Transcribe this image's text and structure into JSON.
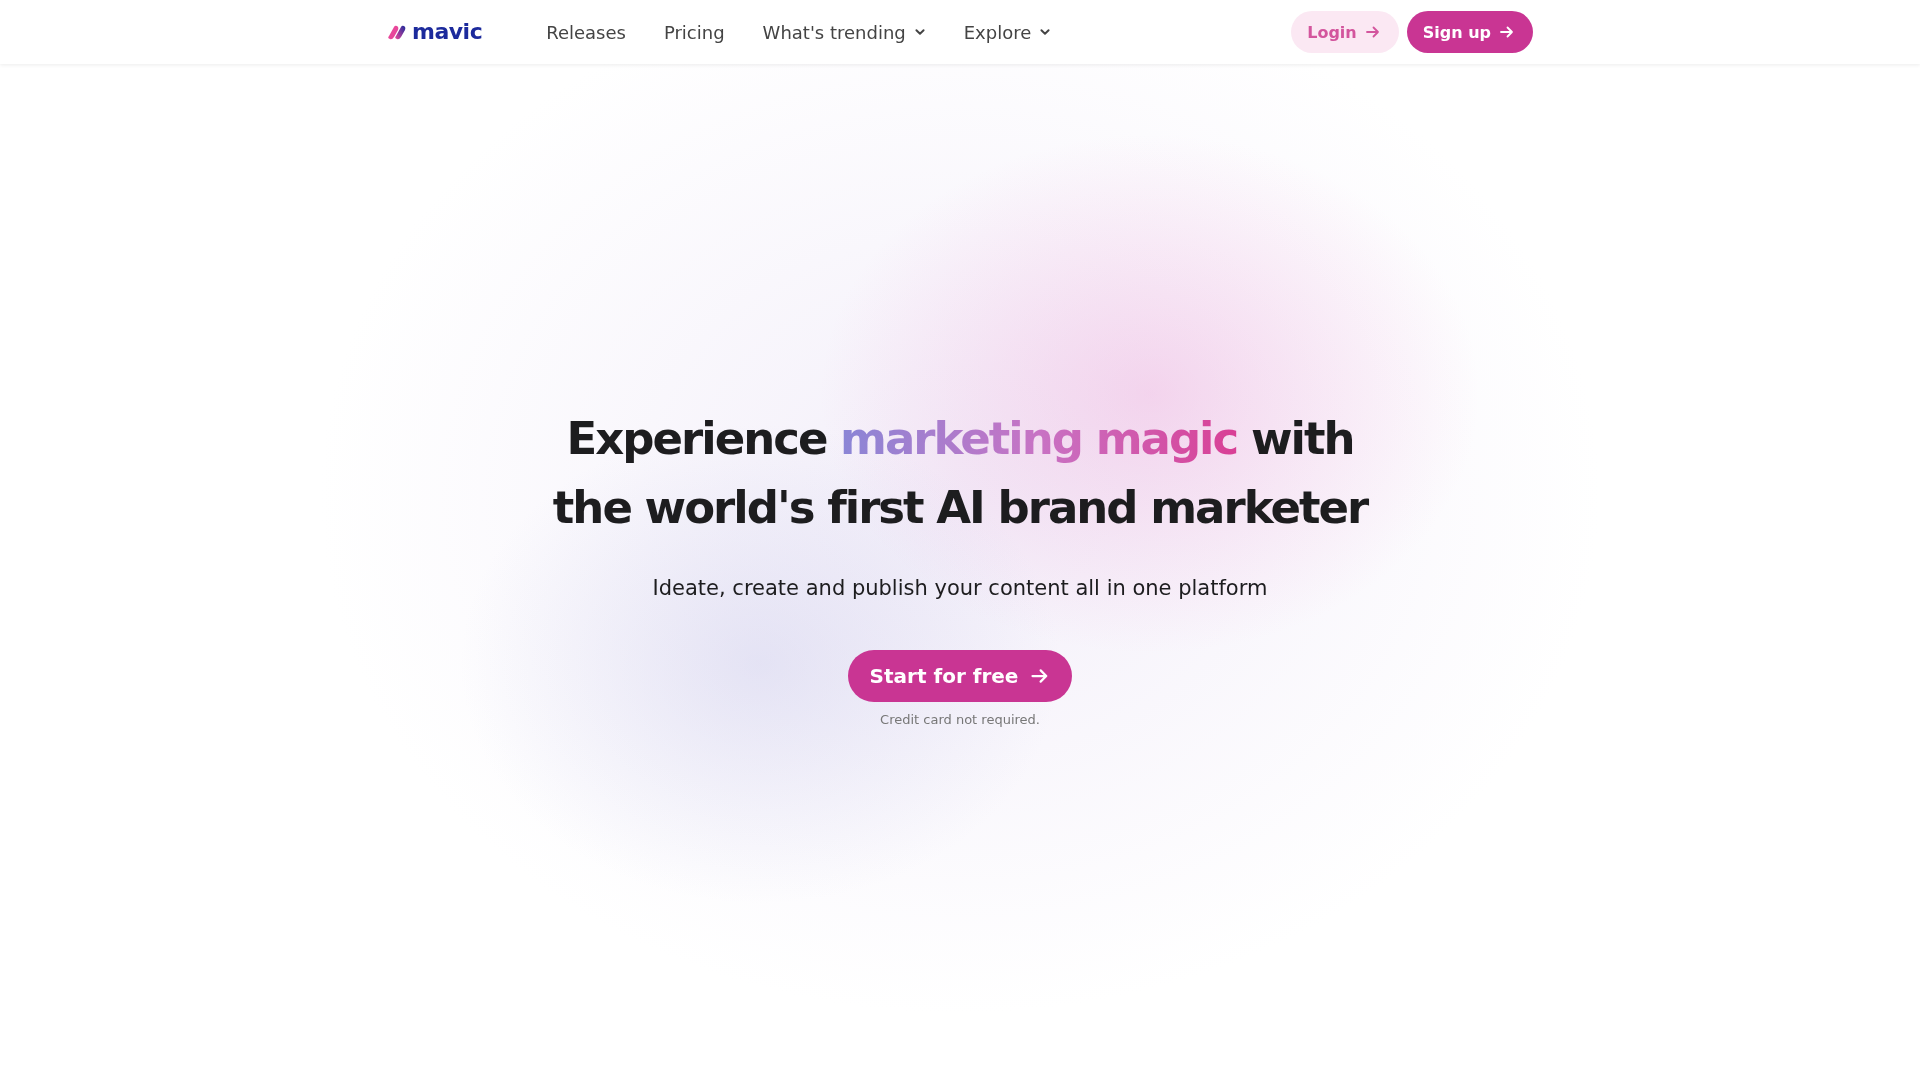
{
  "header": {
    "logo": "mavic",
    "nav": [
      {
        "label": "Releases",
        "has_menu": false
      },
      {
        "label": "Pricing",
        "has_menu": false
      },
      {
        "label": "What's trending",
        "has_menu": true
      },
      {
        "label": "Explore",
        "has_menu": true
      }
    ],
    "actions": [
      {
        "label": "Login",
        "kind": "secondary"
      },
      {
        "label": "Sign up",
        "kind": "primary"
      }
    ]
  },
  "hero": {
    "headline": {
      "before": "Experience ",
      "highlight": "marketing magic",
      "after": " with the world's first AI brand marketer"
    },
    "subtitle": "Ideate, create and publish your content all in one platform",
    "cta": "Start for free",
    "note": "Credit card not required."
  }
}
